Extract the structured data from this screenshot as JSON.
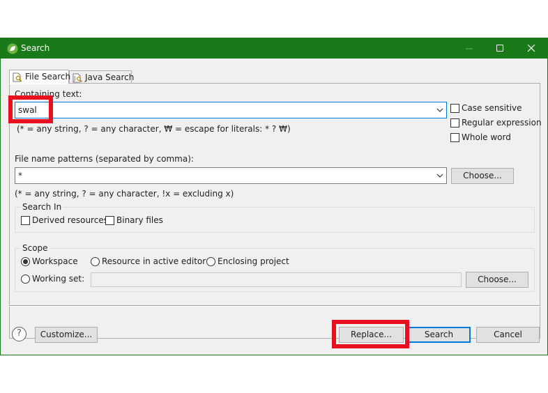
{
  "window": {
    "title": "Search"
  },
  "tabs": [
    {
      "label": "File Search"
    },
    {
      "label": "Java Search"
    }
  ],
  "containing_text": {
    "label": "Containing text:",
    "value": "swal",
    "hint": "(* = any string, ? = any character, ₩ = escape for literals: * ? ₩)"
  },
  "options": {
    "case_sensitive": "Case sensitive",
    "regular_expression": "Regular expression",
    "whole_word": "Whole word"
  },
  "file_patterns": {
    "label": "File name patterns (separated by comma):",
    "value": "*",
    "hint": "(* = any string, ? = any character, !x = excluding x)",
    "choose": "Choose..."
  },
  "search_in": {
    "title": "Search In",
    "derived": "Derived resources",
    "binary": "Binary files"
  },
  "scope": {
    "title": "Scope",
    "workspace": "Workspace",
    "resource": "Resource in active editor",
    "enclosing": "Enclosing project",
    "working_set": "Working set:",
    "choose": "Choose..."
  },
  "footer": {
    "help": "?",
    "customize": "Customize...",
    "replace": "Replace...",
    "search": "Search",
    "cancel": "Cancel"
  },
  "colors": {
    "titlebar": "#1a7a1a",
    "highlight": "#e8101e",
    "focus": "#0078d7"
  }
}
